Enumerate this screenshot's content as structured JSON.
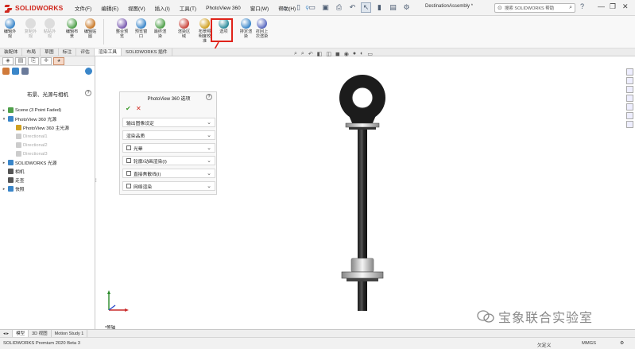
{
  "app": {
    "logo_text": "SOLIDWORKS"
  },
  "menu": [
    "文件(F)",
    "编辑(E)",
    "视图(V)",
    "插入(I)",
    "工具(T)",
    "PhotoView 360",
    "窗口(W)",
    "帮助(H)"
  ],
  "toolbar": {
    "destination": "DestinationAssembly *",
    "search_placeholder": "搜索 SOLIDWORKS 帮助"
  },
  "ribbon": [
    {
      "label": "编辑外\n观",
      "color": "#3a86c9",
      "disabled": false
    },
    {
      "label": "复制外\n观",
      "color": "#aaa",
      "disabled": true
    },
    {
      "label": "粘贴外\n观",
      "color": "#aaa",
      "disabled": true
    },
    {
      "label": "编辑布\n景",
      "color": "#4fa04a",
      "disabled": false
    },
    {
      "label": "编辑贴\n图",
      "color": "#c97a2a",
      "disabled": false
    },
    {
      "label": "整合预\n览",
      "color": "#7a5bb0",
      "disabled": false
    },
    {
      "label": "预览窗\n口",
      "color": "#3a86c9",
      "disabled": false
    },
    {
      "label": "最终渲\n染",
      "color": "#4fa04a",
      "disabled": false
    },
    {
      "label": "渲染区\n域",
      "color": "#c9443a",
      "disabled": false
    },
    {
      "label": "布景照\n明度校\n准",
      "color": "#d0a020",
      "disabled": false
    },
    {
      "label": "选项",
      "color": "#2a8a9a",
      "disabled": false
    },
    {
      "label": "排定渲\n染",
      "color": "#3a86c9",
      "disabled": false
    },
    {
      "label": "召回上\n次渲染",
      "color": "#5a6ac0",
      "disabled": false
    }
  ],
  "tabs": [
    "装配体",
    "布局",
    "草图",
    "标注",
    "评估",
    "渲染工具",
    "SOLIDWORKS 插件"
  ],
  "feature_manager": {
    "title": "布景、光源与相机",
    "tree": [
      {
        "label": "Scene (3 Point Faded)",
        "indent": 0,
        "arrow": "▸",
        "grey": false,
        "color": "#4fa04a"
      },
      {
        "label": "PhotoView 360 光源",
        "indent": 0,
        "arrow": "▾",
        "grey": false,
        "color": "#3a86c9"
      },
      {
        "label": "PhotoView 360 主光源",
        "indent": 1,
        "arrow": "",
        "grey": false,
        "color": "#d0a020"
      },
      {
        "label": "Directional1",
        "indent": 1,
        "arrow": "",
        "grey": true,
        "color": "#ccc"
      },
      {
        "label": "Directional2",
        "indent": 1,
        "arrow": "",
        "grey": true,
        "color": "#ccc"
      },
      {
        "label": "Directional3",
        "indent": 1,
        "arrow": "",
        "grey": true,
        "color": "#ccc"
      },
      {
        "label": "SOLIDWORKS 光源",
        "indent": 0,
        "arrow": "▸",
        "grey": false,
        "color": "#3a86c9"
      },
      {
        "label": "相机",
        "indent": 0,
        "arrow": "",
        "grey": false,
        "color": "#555"
      },
      {
        "label": "走查",
        "indent": 0,
        "arrow": "",
        "grey": false,
        "color": "#555"
      },
      {
        "label": "快照",
        "indent": 0,
        "arrow": "▸",
        "grey": false,
        "color": "#3a86c9"
      }
    ]
  },
  "property_manager": {
    "title": "PhotoView 360 选项",
    "sections": [
      {
        "label": "输出图像设定",
        "checkbox": false
      },
      {
        "label": "渲染品质",
        "checkbox": false
      },
      {
        "label": "光晕",
        "checkbox": true
      },
      {
        "label": "轮廓/动画渲染(I)",
        "checkbox": true
      },
      {
        "label": "直接焦散线(I)",
        "checkbox": true
      },
      {
        "label": "网络渲染",
        "checkbox": true
      }
    ]
  },
  "viewport": {
    "axis_label": "*等轴"
  },
  "bottom_tabs": [
    "模型",
    "3D 视图",
    "Motion Study 1"
  ],
  "status": {
    "left": "SOLIDWORKS Premium 2020 Beta 3",
    "mid": "欠定义",
    "units": "MMGS"
  },
  "watermark": "宝象联合实验室"
}
